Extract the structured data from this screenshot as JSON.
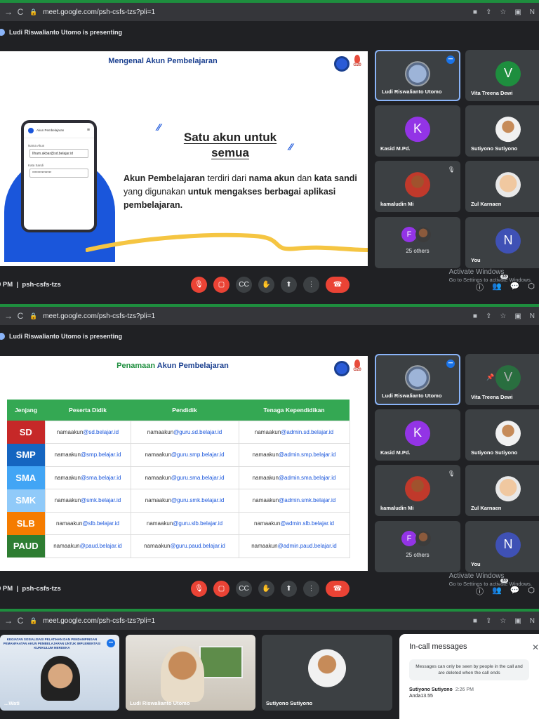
{
  "browser": {
    "url_1": "meet.google.com/psh-csfs-tzs?pli=1",
    "url_2": "meet.google.com/psh-csfs-tzs?pli=1",
    "url_3": "meet.google.com/psh-csfs-tzs?pli=1"
  },
  "presenting_banner": "Ludi Riswalianto Utomo is presenting",
  "slide1": {
    "title": "Mengenal Akun Pembelajaran",
    "phone_header": "Akun Pembelajaran",
    "phone_label_name": "Nama Akun",
    "phone_value_name": "Ilham.akbar@sd.belajar.id",
    "phone_label_pass": "Kata Sandi",
    "phone_value_pass": "**************",
    "headline": "Satu akun untuk semua",
    "para_1": "Akun Pembelajaran",
    "para_2": " terdiri dari ",
    "para_3": "nama akun",
    "para_4": " dan ",
    "para_5": "kata sandi",
    "para_6": " yang digunakan ",
    "para_7": "untuk mengakses berbagai aplikasi pembelajaran."
  },
  "slide2": {
    "title_a": "Penamaan ",
    "title_b": "Akun Pembelajaran",
    "headers": [
      "Jenjang",
      "Peserta Didik",
      "Pendidik",
      "Tenaga Kependidikan"
    ],
    "rows": [
      {
        "level": "SD",
        "color": "#c62828",
        "c1a": "namaakun",
        "c1b": "@sd.belajar.id",
        "c2a": "namaakun",
        "c2b": "@guru.sd.belajar.id",
        "c3a": "namaakun",
        "c3b": "@admin.sd.belajar.id"
      },
      {
        "level": "SMP",
        "color": "#1565c0",
        "c1a": "namaakun",
        "c1b": "@smp.belajar.id",
        "c2a": "namaakun",
        "c2b": "@guru.smp.belajar.id",
        "c3a": "namaakun",
        "c3b": "@admin.smp.belajar.id"
      },
      {
        "level": "SMA",
        "color": "#42a5f5",
        "c1a": "namaakun",
        "c1b": "@sma.belajar.id",
        "c2a": "namaakun",
        "c2b": "@guru.sma.belajar.id",
        "c3a": "namaakun",
        "c3b": "@admin.sma.belajar.id"
      },
      {
        "level": "SMK",
        "color": "#90caf9",
        "c1a": "namaakun",
        "c1b": "@smk.belajar.id",
        "c2a": "namaakun",
        "c2b": "@guru.smk.belajar.id",
        "c3a": "namaakun",
        "c3b": "@admin.smk.belajar.id"
      },
      {
        "level": "SLB",
        "color": "#f57c00",
        "c1a": "namaakun",
        "c1b": "@slb.belajar.id",
        "c2a": "namaakun",
        "c2b": "@guru.slb.belajar.id",
        "c3a": "namaakun",
        "c3b": "@admin.slb.belajar.id"
      },
      {
        "level": "PAUD",
        "color": "#2e7d32",
        "c1a": "namaakun",
        "c1b": "@paud.belajar.id",
        "c2a": "namaakun",
        "c2b": "@guru.paud.belajar.id",
        "c3a": "namaakun",
        "c3b": "@admin.paud.belajar.id"
      }
    ]
  },
  "participants": {
    "p1": "Ludi Riswalianto Utomo",
    "p2": "Vita Treena Dewi",
    "p2_initial": "V",
    "p3": "Kasid M.Pd.",
    "p3_initial": "K",
    "p4": "Sutiyono Sutiyono",
    "p5": "kamaludin Mi",
    "p6": "Zul Karnaen",
    "p7": "25 others",
    "p7_initial": "F",
    "p8": "You",
    "p8_initial": "N"
  },
  "controls": {
    "time_1": "9 PM",
    "time_2": "0 PM",
    "meeting_code": "psh-csfs-tzs",
    "people_count": "33"
  },
  "activate": {
    "line1": "Activate Windows",
    "line2": "Go to Settings to activate Windows."
  },
  "bottom": {
    "banner_text": "KEGIATAN SOSIALISASI PELATIHAN DAN PENDAMPINGAN PEMANFAATAN AKUN PEMBELAJARAN UNTUK IMPLEMENTASI KURIKULUM MERDEKA",
    "v1_name": "...Wati",
    "v2_name": "Ludi Riswalianto Utomo",
    "v3_name": "Sutiyono Sutiyono",
    "chat_title": "In-call messages",
    "chat_note": "Messages can only be seen by people in the call and are deleted when the call ends",
    "chat_sender": "Sutiyono Sutiyono",
    "chat_time": "2:26 PM",
    "chat_msg": "Anda13.55"
  }
}
